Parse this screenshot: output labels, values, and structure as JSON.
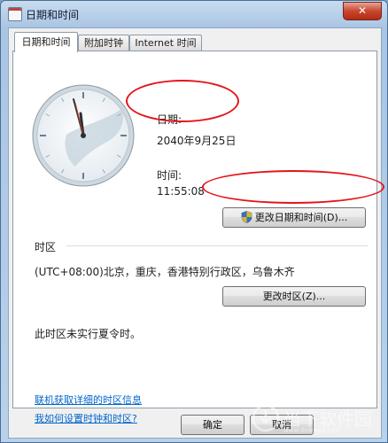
{
  "window": {
    "title": "日期和时间",
    "close_label": "✕"
  },
  "tabs": [
    {
      "label": "日期和时间"
    },
    {
      "label": "附加时钟"
    },
    {
      "label": "Internet 时间"
    }
  ],
  "date": {
    "label": "日期:",
    "value": "2040年9月25日"
  },
  "time": {
    "label": "时间:",
    "value": "11:55:08"
  },
  "change_datetime_button": "更改日期和时间(D)...",
  "timezone": {
    "section_label": "时区",
    "value": "(UTC+08:00)北京，重庆，香港特别行政区，乌鲁木齐",
    "change_button": "更改时区(Z)...",
    "dst_note": "此时区未实行夏令时。"
  },
  "links": {
    "online_info": "联机获取详细的时区信息",
    "how_to_set": "我如何设置时钟和时区?"
  },
  "footer": {
    "ok": "确定",
    "cancel": "取消"
  },
  "watermark": {
    "text": "当下软件园",
    "sub": "www.downxia.com"
  },
  "colors": {
    "annotation": "#e4151b",
    "link": "#0066cc"
  }
}
